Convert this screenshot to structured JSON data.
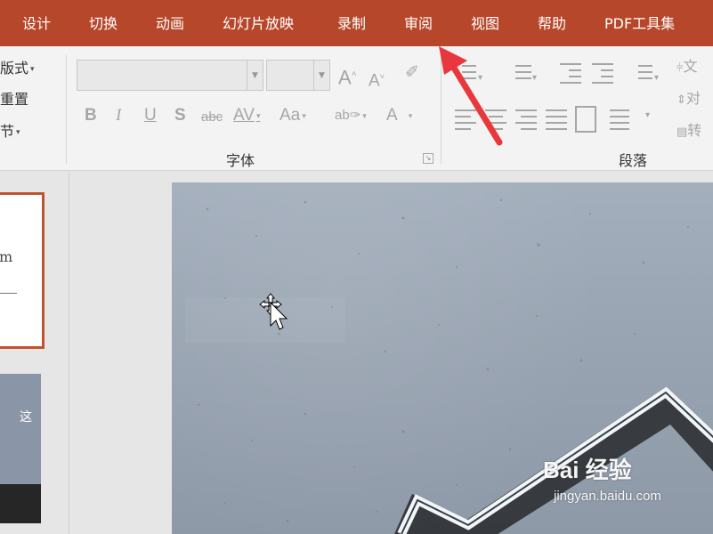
{
  "tabs": [
    "设计",
    "切换",
    "动画",
    "幻灯片放映",
    "录制",
    "审阅",
    "视图",
    "帮助",
    "PDF工具集"
  ],
  "slides_group": {
    "layout_label": "版式",
    "reset_label": "重置",
    "section_label": "节"
  },
  "font_group": {
    "label": "字体",
    "font_name": "",
    "font_size": "",
    "grow_font": "A",
    "shrink_font": "A",
    "bold": "B",
    "italic": "I",
    "underline": "U",
    "shadow": "S",
    "strikethrough": "abc",
    "spacing": "AV",
    "change_case": "Aa",
    "highlight": "ab",
    "font_color": "A"
  },
  "paragraph_group": {
    "label": "段落",
    "text_direction": "文",
    "align_text": "对",
    "convert": "转"
  },
  "slide_thumbs": {
    "thumb1_text": "m",
    "thumb2_text": "这"
  },
  "watermark": {
    "brand": "Bai 经验",
    "url": "jingyan.baidu.com"
  },
  "colors": {
    "accent": "#b7472a",
    "annotation_arrow": "#e8383d",
    "ribbon_bg": "#f3f3f3"
  }
}
